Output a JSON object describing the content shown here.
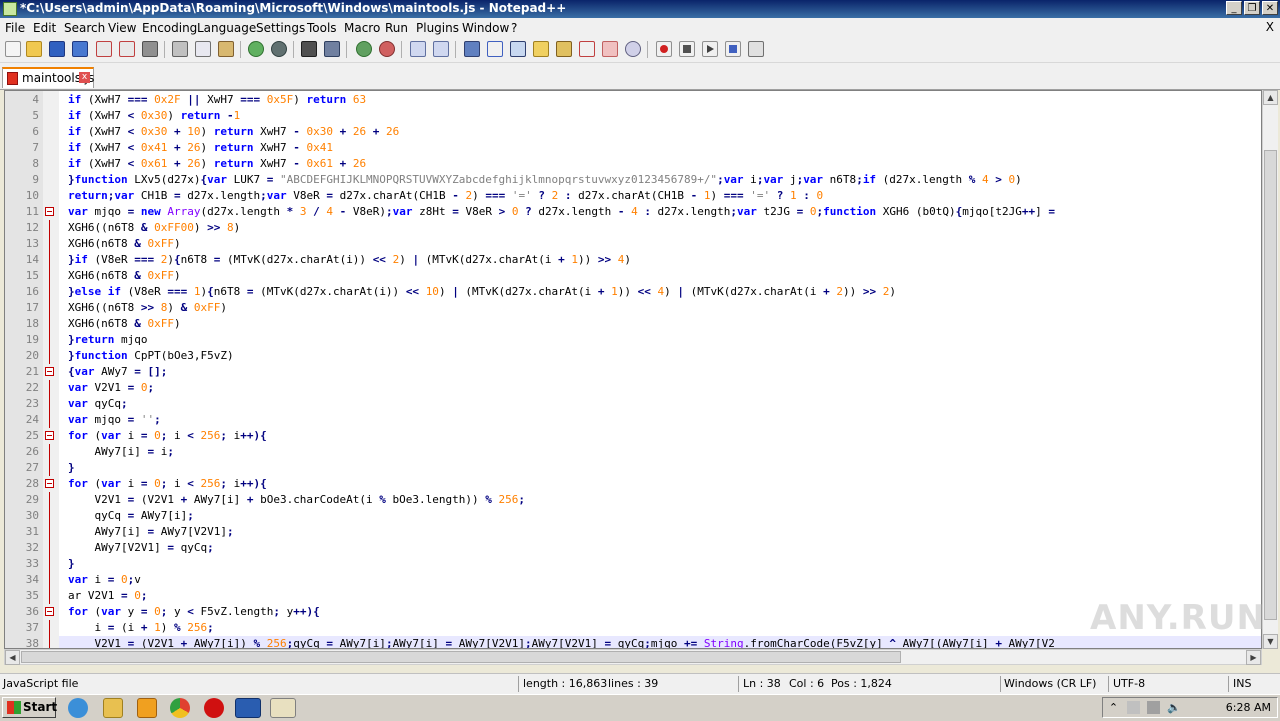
{
  "window": {
    "title": "*C:\\Users\\admin\\AppData\\Roaming\\Microsoft\\Windows\\maintools.js - Notepad++",
    "minimize": "_",
    "restore": "❐",
    "close": "✕"
  },
  "menu": [
    "File",
    "Edit",
    "Search",
    "View",
    "Encoding",
    "Language",
    "Settings",
    "Tools",
    "Macro",
    "Run",
    "Plugins",
    "Window",
    "?"
  ],
  "menu_close": "X",
  "tab": {
    "label": "maintools.js",
    "close": "x"
  },
  "editor": {
    "current_line": 38,
    "lines": [
      {
        "n": "4",
        "fold": "",
        "code": "<span class='k'>if</span> (XwH7 <span class='o'>===</span> <span class='n'>0x2F</span> <span class='o'>||</span> XwH7 <span class='o'>===</span> <span class='n'>0x5F</span>) <span class='k'>return</span> <span class='n'>63</span>"
      },
      {
        "n": "5",
        "fold": "",
        "code": "<span class='k'>if</span> (XwH7 <span class='o'>&lt;</span> <span class='n'>0x30</span>) <span class='k'>return</span> <span class='o'>-</span><span class='n'>1</span>"
      },
      {
        "n": "6",
        "fold": "",
        "code": "<span class='k'>if</span> (XwH7 <span class='o'>&lt;</span> <span class='n'>0x30</span> <span class='o'>+</span> <span class='n'>10</span>) <span class='k'>return</span> XwH7 <span class='o'>-</span> <span class='n'>0x30</span> <span class='o'>+</span> <span class='n'>26</span> <span class='o'>+</span> <span class='n'>26</span>"
      },
      {
        "n": "7",
        "fold": "",
        "code": "<span class='k'>if</span> (XwH7 <span class='o'>&lt;</span> <span class='n'>0x41</span> <span class='o'>+</span> <span class='n'>26</span>) <span class='k'>return</span> XwH7 <span class='o'>-</span> <span class='n'>0x41</span>"
      },
      {
        "n": "8",
        "fold": "",
        "code": "<span class='k'>if</span> (XwH7 <span class='o'>&lt;</span> <span class='n'>0x61</span> <span class='o'>+</span> <span class='n'>26</span>) <span class='k'>return</span> XwH7 <span class='o'>-</span> <span class='n'>0x61</span> <span class='o'>+</span> <span class='n'>26</span>"
      },
      {
        "n": "9",
        "fold": "",
        "code": "<span class='o'>}</span><span class='k'>function</span> LXv5(d27x)<span class='o'>{</span><span class='k'>var</span> LUK7 <span class='o'>=</span> <span class='s'>\"ABCDEFGHIJKLMNOPQRSTUVWXYZabcdefghijklmnopqrstuvwxyz0123456789+/\"</span><span class='o'>;</span><span class='k'>var</span> i<span class='o'>;</span><span class='k'>var</span> j<span class='o'>;</span><span class='k'>var</span> n6T8<span class='o'>;</span><span class='k'>if</span> (d27x.length <span class='o'>%</span> <span class='n'>4</span> <span class='o'>&gt;</span> <span class='n'>0</span>)"
      },
      {
        "n": "10",
        "fold": "",
        "code": "<span class='k'>return</span><span class='o'>;</span><span class='k'>var</span> CH1B <span class='o'>=</span> d27x.length<span class='o'>;</span><span class='k'>var</span> V8eR <span class='o'>=</span> d27x.charAt(CH1B <span class='o'>-</span> <span class='n'>2</span>) <span class='o'>===</span> <span class='s'>'='</span> <span class='o'>?</span> <span class='n'>2</span> <span class='o'>:</span> d27x.charAt(CH1B <span class='o'>-</span> <span class='n'>1</span>) <span class='o'>===</span> <span class='s'>'='</span> <span class='o'>?</span> <span class='n'>1</span> <span class='o'>:</span> <span class='n'>0</span>"
      },
      {
        "n": "11",
        "fold": "box",
        "code": "<span class='k'>var</span> mjqo <span class='o'>=</span> <span class='k'>new</span> <span class='t'>Array</span>(d27x.length <span class='o'>*</span> <span class='n'>3</span> <span class='o'>/</span> <span class='n'>4</span> <span class='o'>-</span> V8eR)<span class='o'>;</span><span class='k'>var</span> z8Ht <span class='o'>=</span> V8eR <span class='o'>&gt;</span> <span class='n'>0</span> <span class='o'>?</span> d27x.length <span class='o'>-</span> <span class='n'>4</span> <span class='o'>:</span> d27x.length<span class='o'>;</span><span class='k'>var</span> t2JG <span class='o'>=</span> <span class='n'>0</span><span class='o'>;</span><span class='k'>function</span> XGH6 (b0tQ)<span class='o'>{</span>mjqo[t2JG<span class='o'>++</span>] <span class='o'>=</span>"
      },
      {
        "n": "12",
        "fold": "line",
        "code": "XGH6((n6T8 <span class='o'>&amp;</span> <span class='n'>0xFF00</span>) <span class='o'>&gt;&gt;</span> <span class='n'>8</span>)"
      },
      {
        "n": "13",
        "fold": "line",
        "code": "XGH6(n6T8 <span class='o'>&amp;</span> <span class='n'>0xFF</span>)"
      },
      {
        "n": "14",
        "fold": "line",
        "code": "<span class='o'>}</span><span class='k'>if</span> (V8eR <span class='o'>===</span> <span class='n'>2</span>)<span class='o'>{</span>n6T8 <span class='o'>=</span> (MTvK(d27x.charAt(i)) <span class='o'>&lt;&lt;</span> <span class='n'>2</span>) <span class='o'>|</span> (MTvK(d27x.charAt(i <span class='o'>+</span> <span class='n'>1</span>)) <span class='o'>&gt;&gt;</span> <span class='n'>4</span>)"
      },
      {
        "n": "15",
        "fold": "line",
        "code": "XGH6(n6T8 <span class='o'>&amp;</span> <span class='n'>0xFF</span>)"
      },
      {
        "n": "16",
        "fold": "line",
        "code": "<span class='o'>}</span><span class='k'>else</span> <span class='k'>if</span> (V8eR <span class='o'>===</span> <span class='n'>1</span>)<span class='o'>{</span>n6T8 <span class='o'>=</span> (MTvK(d27x.charAt(i)) <span class='o'>&lt;&lt;</span> <span class='n'>10</span>) <span class='o'>|</span> (MTvK(d27x.charAt(i <span class='o'>+</span> <span class='n'>1</span>)) <span class='o'>&lt;&lt;</span> <span class='n'>4</span>) <span class='o'>|</span> (MTvK(d27x.charAt(i <span class='o'>+</span> <span class='n'>2</span>)) <span class='o'>&gt;&gt;</span> <span class='n'>2</span>)"
      },
      {
        "n": "17",
        "fold": "line",
        "code": "XGH6((n6T8 <span class='o'>&gt;&gt;</span> <span class='n'>8</span>) <span class='o'>&amp;</span> <span class='n'>0xFF</span>)"
      },
      {
        "n": "18",
        "fold": "line",
        "code": "XGH6(n6T8 <span class='o'>&amp;</span> <span class='n'>0xFF</span>)"
      },
      {
        "n": "19",
        "fold": "line",
        "code": "<span class='o'>}</span><span class='k'>return</span> mjqo"
      },
      {
        "n": "20",
        "fold": "line",
        "code": "<span class='o'>}</span><span class='k'>function</span> CpPT(bOe3,F5vZ)"
      },
      {
        "n": "21",
        "fold": "box",
        "code": "<span class='o'>{</span><span class='k'>var</span> AWy7 <span class='o'>=</span> <span class='o'>[];</span>"
      },
      {
        "n": "22",
        "fold": "line",
        "code": "<span class='k'>var</span> V2V1 <span class='o'>=</span> <span class='n'>0</span><span class='o'>;</span>"
      },
      {
        "n": "23",
        "fold": "line",
        "code": "<span class='k'>var</span> qyCq<span class='o'>;</span>"
      },
      {
        "n": "24",
        "fold": "line",
        "code": "<span class='k'>var</span> mjqo <span class='o'>=</span> <span class='s'>''</span><span class='o'>;</span>"
      },
      {
        "n": "25",
        "fold": "box",
        "code": "<span class='k'>for</span> (<span class='k'>var</span> i <span class='o'>=</span> <span class='n'>0</span><span class='o'>;</span> i <span class='o'>&lt;</span> <span class='n'>256</span><span class='o'>;</span> i<span class='o'>++){</span>"
      },
      {
        "n": "26",
        "fold": "line",
        "code": "    AWy7[i] <span class='o'>=</span> i<span class='o'>;</span>"
      },
      {
        "n": "27",
        "fold": "line",
        "code": "<span class='o'>}</span>"
      },
      {
        "n": "28",
        "fold": "box",
        "code": "<span class='k'>for</span> (<span class='k'>var</span> i <span class='o'>=</span> <span class='n'>0</span><span class='o'>;</span> i <span class='o'>&lt;</span> <span class='n'>256</span><span class='o'>;</span> i<span class='o'>++){</span>"
      },
      {
        "n": "29",
        "fold": "line",
        "code": "    V2V1 <span class='o'>=</span> (V2V1 <span class='o'>+</span> AWy7[i] <span class='o'>+</span> bOe3.charCodeAt(i <span class='o'>%</span> bOe3.length)) <span class='o'>%</span> <span class='n'>256</span><span class='o'>;</span>"
      },
      {
        "n": "30",
        "fold": "line",
        "code": "    qyCq <span class='o'>=</span> AWy7[i]<span class='o'>;</span>"
      },
      {
        "n": "31",
        "fold": "line",
        "code": "    AWy7[i] <span class='o'>=</span> AWy7[V2V1]<span class='o'>;</span>"
      },
      {
        "n": "32",
        "fold": "line",
        "code": "    AWy7[V2V1] <span class='o'>=</span> qyCq<span class='o'>;</span>"
      },
      {
        "n": "33",
        "fold": "line",
        "code": "<span class='o'>}</span>"
      },
      {
        "n": "34",
        "fold": "line",
        "code": "<span class='k'>var</span> i <span class='o'>=</span> <span class='n'>0</span><span class='o'>;</span>v"
      },
      {
        "n": "35",
        "fold": "line",
        "code": "ar V2V1 <span class='o'>=</span> <span class='n'>0</span><span class='o'>;</span>"
      },
      {
        "n": "36",
        "fold": "box",
        "code": "<span class='k'>for</span> (<span class='k'>var</span> y <span class='o'>=</span> <span class='n'>0</span><span class='o'>;</span> y <span class='o'>&lt;</span> F5vZ.length<span class='o'>;</span> y<span class='o'>++){</span>"
      },
      {
        "n": "37",
        "fold": "line",
        "code": "    i <span class='o'>=</span> (i <span class='o'>+</span> <span class='n'>1</span>) <span class='o'>%</span> <span class='n'>256</span><span class='o'>;</span>"
      },
      {
        "n": "38",
        "fold": "line",
        "code": "    V2V1 <span class='o'>=</span> (V2V1 <span class='o'>+</span> AWy7[i]) <span class='o'>%</span> <span class='n'>256</span><span class='o'>;</span>qyCq <span class='o'>=</span> AWy7[i]<span class='o'>;</span>AWy7[i] <span class='o'>=</span> AWy7[V2V1]<span class='o'>;</span>AWy7[V2V1] <span class='o'>=</span> qyCq<span class='o'>;</span>mjqo <span class='o'>+=</span> <span class='t'>String</span>.fromCharCode(F5vZ[y] <span class='o'>^</span> AWy7[(AWy7[i] <span class='o'>+</span> AWy7[V2"
      }
    ]
  },
  "watermark": "ANY.RUN",
  "status": {
    "language": "JavaScript file",
    "length": "length : 16,863",
    "lines": "lines : 39",
    "ln": "Ln : 38",
    "col": "Col : 6",
    "pos": "Pos : 1,824",
    "eol": "Windows (CR LF)",
    "encoding": "UTF-8",
    "mode": "INS"
  },
  "taskbar": {
    "start": "Start",
    "clock": "6:28 AM"
  }
}
